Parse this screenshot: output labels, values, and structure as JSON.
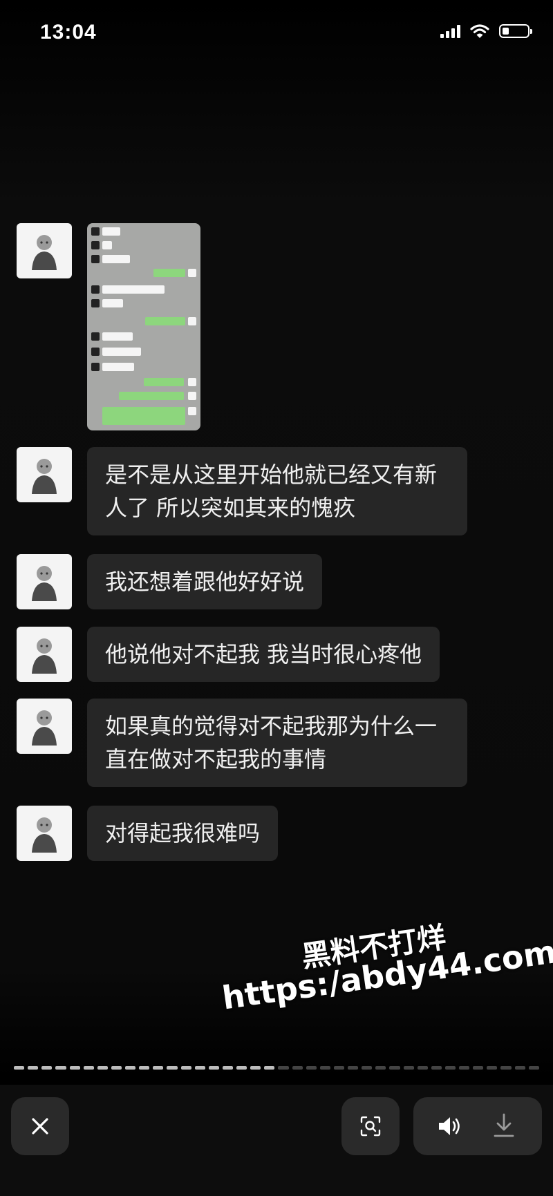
{
  "status_bar": {
    "time": "13:04"
  },
  "messages": [
    {
      "type": "image"
    },
    {
      "type": "text",
      "text": "是不是从这里开始他就已经又有新人了 所以突如其来的愧疚"
    },
    {
      "type": "text",
      "text": "我还想着跟他好好说"
    },
    {
      "type": "text",
      "text": "他说他对不起我 我当时很心疼他"
    },
    {
      "type": "text",
      "text": "如果真的觉得对不起我那为什么一直在做对不起我的事情"
    },
    {
      "type": "text",
      "text": "对得起我很难吗"
    }
  ],
  "watermark": {
    "title": "黑料不打烊",
    "url": "https:/abdy44.com"
  },
  "progress": {
    "total_segments": 38,
    "seen_segments": 19
  },
  "toolbar": {
    "close_icon": "close-icon",
    "scan_icon": "scan-text-icon",
    "speaker_icon": "speaker-icon",
    "download_icon": "download-icon"
  },
  "colors": {
    "bubble": "#262626",
    "background": "#0a0a0a",
    "thumb_green": "#8dd67d"
  }
}
